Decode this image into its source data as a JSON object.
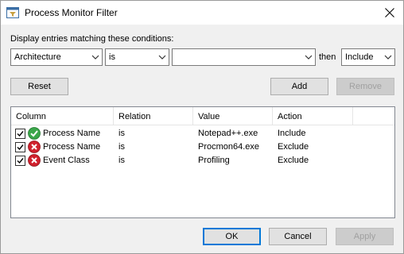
{
  "window": {
    "title": "Process Monitor Filter"
  },
  "conditions_label": "Display entries matching these conditions:",
  "filter": {
    "column_value": "Architecture",
    "relation_value": "is",
    "value_value": "",
    "then_label": "then",
    "action_value": "Include"
  },
  "buttons": {
    "reset": "Reset",
    "add": "Add",
    "remove": "Remove",
    "ok": "OK",
    "cancel": "Cancel",
    "apply": "Apply"
  },
  "list": {
    "columns": [
      "Column",
      "Relation",
      "Value",
      "Action"
    ],
    "rows": [
      {
        "checked": true,
        "status_icon": "check-icon",
        "column": "Process Name",
        "relation": "is",
        "value": "Notepad++.exe",
        "action": "Include"
      },
      {
        "checked": true,
        "status_icon": "exclude-icon",
        "column": "Process Name",
        "relation": "is",
        "value": "Procmon64.exe",
        "action": "Exclude"
      },
      {
        "checked": true,
        "status_icon": "exclude-icon",
        "column": "Event Class",
        "relation": "is",
        "value": "Profiling",
        "action": "Exclude"
      }
    ]
  },
  "colors": {
    "include_green": "#3aa64a",
    "exclude_red": "#d0202d",
    "default_button_border": "#0078d7"
  }
}
